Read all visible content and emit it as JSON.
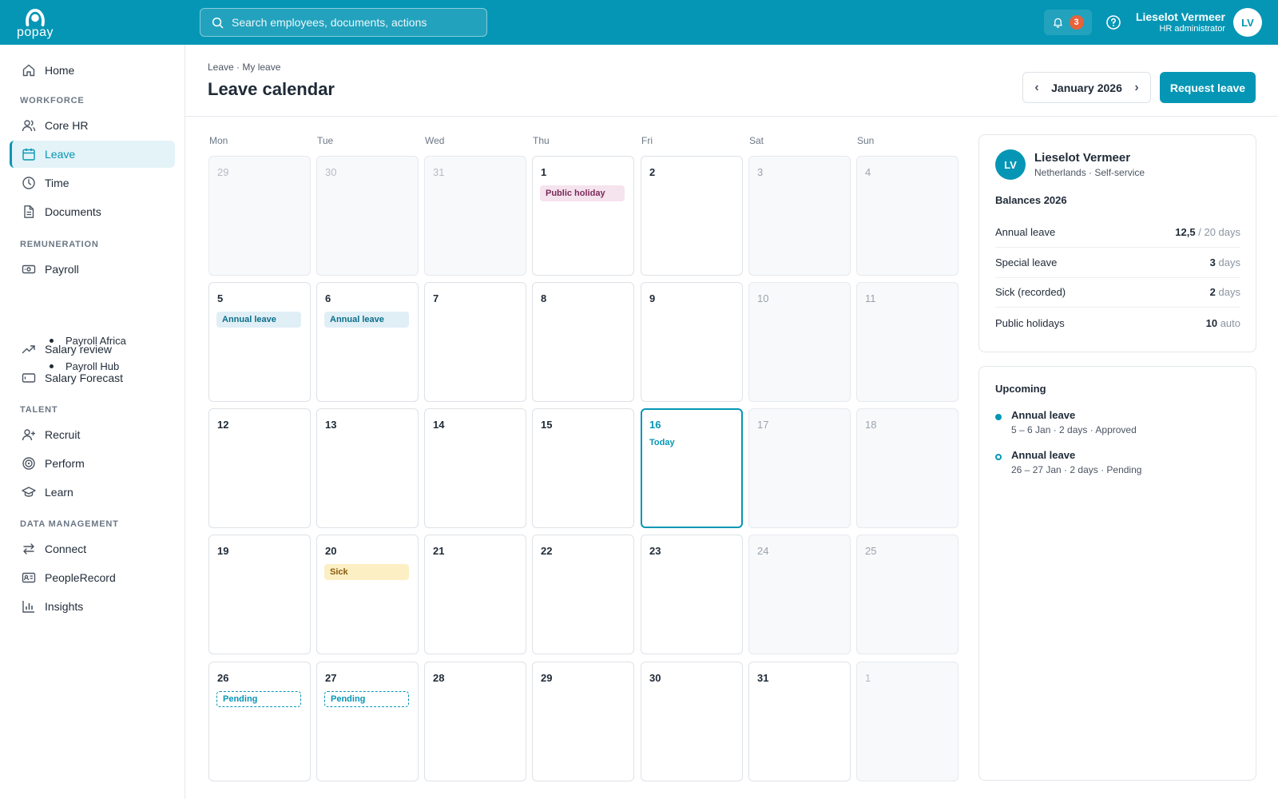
{
  "app": {
    "logo_text": "popay",
    "search_placeholder": "Search employees, documents, actions",
    "notifications_count": "3",
    "user_name": "Lieselot Vermeer",
    "user_role": "HR administrator",
    "user_initials": "LV"
  },
  "sidebar": {
    "home": "Home",
    "section_workforce": "WORKFORCE",
    "core_hr": "Core HR",
    "leave": "Leave",
    "time": "Time",
    "documents": "Documents",
    "section_remuneration": "REMUNERATION",
    "payroll": "Payroll",
    "payroll_africa": "Payroll Africa",
    "payroll_hub": "Payroll Hub",
    "salary_review": "Salary review",
    "salary_forecast": "Salary Forecast",
    "section_talent": "TALENT",
    "recruit": "Recruit",
    "perform": "Perform",
    "learn": "Learn",
    "section_data": "DATA MANAGEMENT",
    "connect": "Connect",
    "peoplerecord": "PeopleRecord",
    "insights": "Insights"
  },
  "header": {
    "breadcrumb": "Leave · My leave",
    "title": "Leave calendar",
    "month": "January 2026",
    "prev": "‹",
    "next": "›",
    "request_button": "Request leave"
  },
  "calendar": {
    "weekdays": [
      "Mon",
      "Tue",
      "Wed",
      "Thu",
      "Fri",
      "Sat",
      "Sun"
    ],
    "today_label": "Today",
    "days": [
      {
        "d": "29",
        "muted": true
      },
      {
        "d": "30",
        "muted": true
      },
      {
        "d": "31",
        "muted": true
      },
      {
        "d": "1",
        "event": "Public holiday",
        "kind": "holiday"
      },
      {
        "d": "2"
      },
      {
        "d": "3",
        "weekend": true
      },
      {
        "d": "4",
        "weekend": true
      },
      {
        "d": "5",
        "event": "Annual leave",
        "kind": "annual"
      },
      {
        "d": "6",
        "event": "Annual leave",
        "kind": "annual"
      },
      {
        "d": "7"
      },
      {
        "d": "8"
      },
      {
        "d": "9"
      },
      {
        "d": "10",
        "weekend": true
      },
      {
        "d": "11",
        "weekend": true
      },
      {
        "d": "12"
      },
      {
        "d": "13"
      },
      {
        "d": "14"
      },
      {
        "d": "15"
      },
      {
        "d": "16",
        "today": true
      },
      {
        "d": "17",
        "weekend": true
      },
      {
        "d": "18",
        "weekend": true
      },
      {
        "d": "19"
      },
      {
        "d": "20",
        "event": "Sick",
        "kind": "sick"
      },
      {
        "d": "21"
      },
      {
        "d": "22"
      },
      {
        "d": "23"
      },
      {
        "d": "24",
        "weekend": true
      },
      {
        "d": "25",
        "weekend": true
      },
      {
        "d": "26",
        "event": "Pending",
        "kind": "pending"
      },
      {
        "d": "27",
        "event": "Pending",
        "kind": "pending"
      },
      {
        "d": "28"
      },
      {
        "d": "29"
      },
      {
        "d": "30"
      },
      {
        "d": "31"
      },
      {
        "d": "1",
        "muted": true
      }
    ]
  },
  "profile": {
    "initials": "LV",
    "name": "Lieselot Vermeer",
    "subtitle": "Netherlands · Self-service",
    "balances_title": "Balances 2026",
    "balances": [
      {
        "label": "Annual leave",
        "value": "12,5",
        "unit": "/ 20 days"
      },
      {
        "label": "Special leave",
        "value": "3",
        "unit": "days"
      },
      {
        "label": "Sick (recorded)",
        "value": "2",
        "unit": "days"
      },
      {
        "label": "Public holidays",
        "value": "10",
        "unit": "auto"
      }
    ]
  },
  "upcoming": {
    "title": "Upcoming",
    "items": [
      {
        "title": "Annual leave",
        "meta": "5 – 6 Jan · 2 days · Approved",
        "status": "approved"
      },
      {
        "title": "Annual leave",
        "meta": "26 – 27 Jan · 2 days · Pending",
        "status": "pending"
      }
    ]
  },
  "colors": {
    "brand": "#0596b5",
    "notification": "#e8623a",
    "holiday_bg": "#f5e3ee",
    "annual_bg": "#e0eff6",
    "sick_bg": "#fcefc4"
  },
  "icons": {
    "search": "search-icon",
    "bell": "bell-icon",
    "help": "help-circle-icon"
  }
}
